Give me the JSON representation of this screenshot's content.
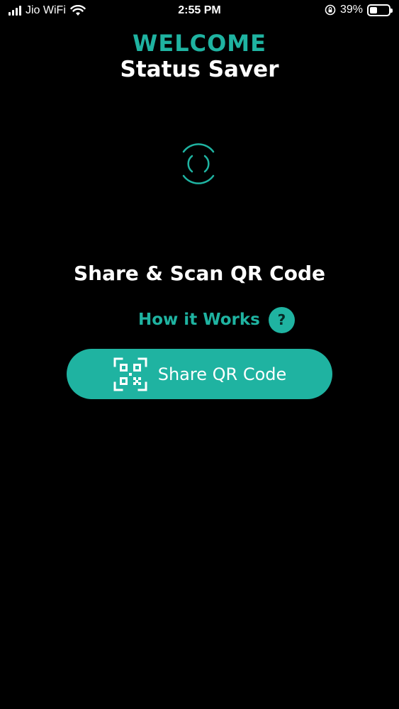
{
  "status_bar": {
    "carrier": "Jio WiFi",
    "time": "2:55 PM",
    "battery_percent": "39%",
    "battery_level": 0.39,
    "icons": [
      "signal-icon",
      "wifi-icon",
      "orientation-lock-icon",
      "battery-icon"
    ]
  },
  "header": {
    "welcome": "WELCOME",
    "app_title": "Status Saver"
  },
  "main": {
    "loader_icon": "loading-spinner-icon",
    "headline": "Share & Scan QR Code",
    "how_it_works": "How it Works",
    "help_glyph": "?",
    "share_button_label": "Share QR Code",
    "share_button_icon": "qr-code-icon"
  },
  "colors": {
    "accent": "#1fb3a1",
    "background": "#000000",
    "text": "#ffffff"
  }
}
